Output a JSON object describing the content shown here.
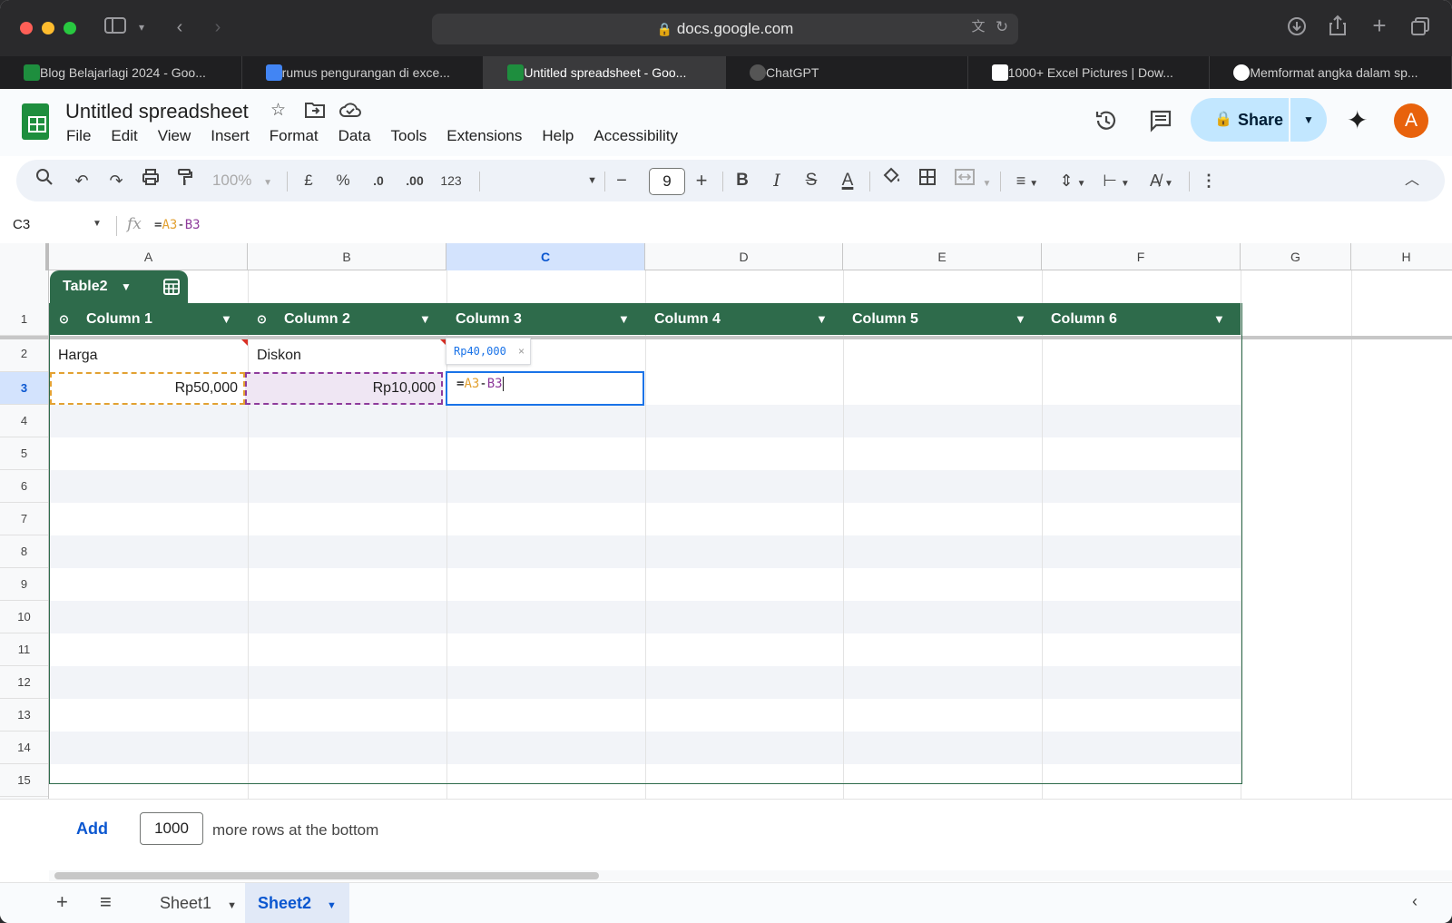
{
  "browser": {
    "url": "docs.google.com",
    "tabs": [
      {
        "label": "Blog Belajarlagi 2024 - Goo...",
        "color": "#1e8e3e"
      },
      {
        "label": "rumus pengurangan di exce...",
        "color": "#4285f4"
      },
      {
        "label": "Untitled spreadsheet - Goo...",
        "color": "#1e8e3e"
      },
      {
        "label": "ChatGPT",
        "color": "#555555"
      },
      {
        "label": "1000+ Excel Pictures | Dow...",
        "color": "#ffffff"
      },
      {
        "label": "Memformat angka dalam sp...",
        "color": "#ffffff"
      }
    ]
  },
  "header": {
    "title": "Untitled spreadsheet",
    "menu": [
      "File",
      "Edit",
      "View",
      "Insert",
      "Format",
      "Data",
      "Tools",
      "Extensions",
      "Help",
      "Accessibility"
    ],
    "share_label": "Share",
    "avatar_letter": "A"
  },
  "toolbar": {
    "zoom": "100%",
    "currency": "£",
    "percent": "%",
    "dec_decrease": ".0",
    "dec_increase": ".00",
    "number_format": "123",
    "font_size": "9"
  },
  "formula_bar": {
    "name_box": "C3",
    "fx": "fx",
    "eq": "=",
    "ref1": "A3",
    "op": "-",
    "ref2": "B3"
  },
  "grid": {
    "columns": [
      "A",
      "B",
      "C",
      "D",
      "E",
      "F",
      "G",
      "H"
    ],
    "rows": [
      "1",
      "2",
      "3",
      "4",
      "5",
      "6",
      "7",
      "8",
      "9",
      "10",
      "11",
      "12",
      "13",
      "14",
      "15"
    ],
    "table_name": "Table2",
    "table_columns": [
      "Column 1",
      "Column 2",
      "Column 3",
      "Column 4",
      "Column 5",
      "Column 6"
    ],
    "cells": {
      "A2": "Harga",
      "B2": "Diskon",
      "A3": "Rp50,000",
      "B3": "Rp10,000"
    },
    "preview_value": "Rp40,000"
  },
  "add_rows": {
    "button": "Add",
    "count": "1000",
    "label": "more rows at the bottom"
  },
  "sheets": [
    "Sheet1",
    "Sheet2"
  ],
  "colors": {
    "table_header": "#2e6b4b",
    "selection": "#1a73e8",
    "ref_a": "#e2a132",
    "ref_b": "#8e3b9b"
  }
}
